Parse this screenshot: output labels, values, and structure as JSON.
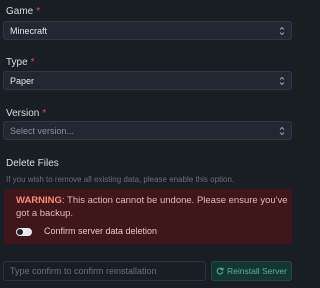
{
  "game": {
    "label": "Game",
    "required_mark": "*",
    "value": "Minecraft"
  },
  "type": {
    "label": "Type",
    "required_mark": "*",
    "value": "Paper"
  },
  "version": {
    "label": "Version",
    "required_mark": "*",
    "placeholder": "Select version..."
  },
  "delete_files": {
    "label": "Delete Files",
    "help": "If you wish to remove all existing data, please enable this option."
  },
  "warning": {
    "title": "WARNING",
    "message": ": This action cannot be undone. Please ensure you've got a backup.",
    "toggle_label": "Confirm server data deletion",
    "toggle_on": false
  },
  "confirm": {
    "placeholder": "Type confirm to confirm reinstallation",
    "button_label": "Reinstall Server"
  },
  "colors": {
    "background": "#191d24",
    "required": "#d9534f",
    "warning_bg": "#3f1619",
    "accent": "#4fb596"
  }
}
